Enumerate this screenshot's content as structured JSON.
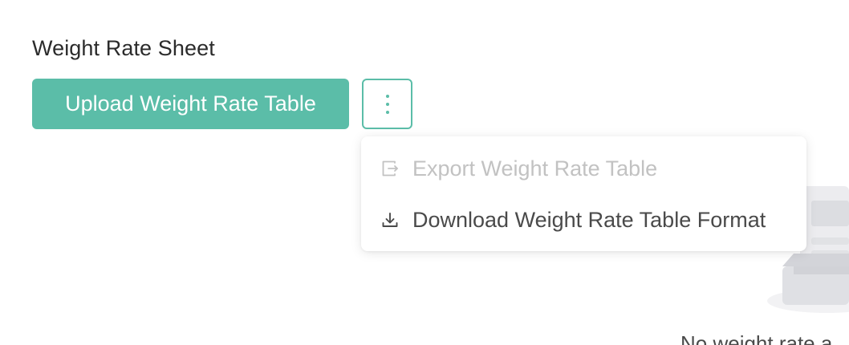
{
  "section": {
    "title": "Weight Rate Sheet"
  },
  "toolbar": {
    "upload_label": "Upload Weight Rate Table",
    "more_icon": "more-vertical-icon"
  },
  "menu": {
    "items": [
      {
        "label": "Export Weight Rate Table",
        "icon": "export-icon",
        "disabled": true
      },
      {
        "label": "Download Weight Rate Table Format",
        "icon": "download-icon",
        "disabled": false
      }
    ]
  },
  "empty_state": {
    "icon": "empty-box-icon",
    "message": "No weight rate a"
  },
  "colors": {
    "accent": "#5bbda8",
    "disabled_text": "#c2c2c2",
    "text": "#4a4a4a"
  }
}
